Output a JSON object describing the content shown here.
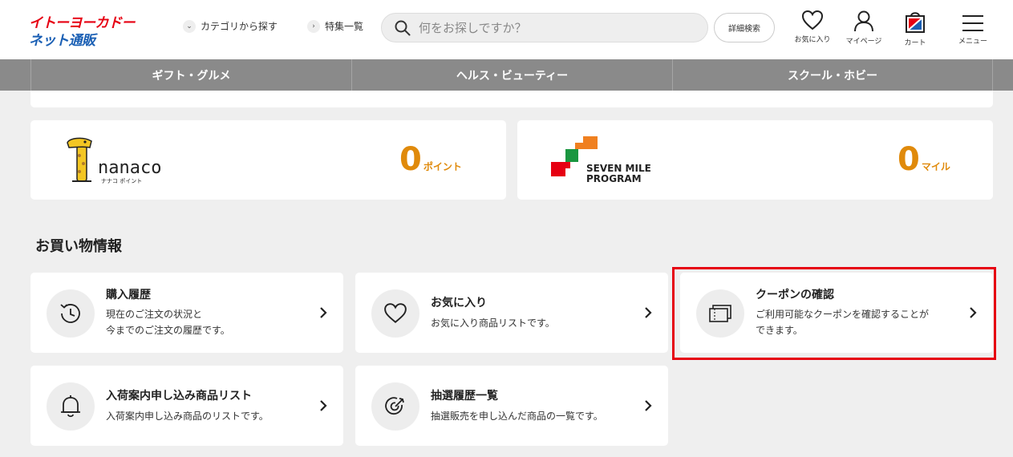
{
  "header": {
    "logo_line1": "イトーヨーカドー",
    "logo_line2": "ネット通販",
    "category_link": "カテゴリから探す",
    "feature_link": "特集一覧",
    "search_placeholder": "何をお探しですか？",
    "advanced_search": "詳細検索",
    "favorites": "お気に入り",
    "mypage": "マイページ",
    "cart": "カート",
    "menu": "メニュー"
  },
  "categories": [
    "ギフト・グルメ",
    "ヘルス・ビューティー",
    "スクール・ホビー"
  ],
  "points": {
    "nanaco": {
      "logo_text": "nanaco",
      "logo_sub": "ナナコ ポイント",
      "value": "0",
      "unit": "ポイント"
    },
    "seven_mile": {
      "logo_line1": "SEVEN MILE",
      "logo_line2": "PROGRAM",
      "value": "0",
      "unit": "マイル"
    }
  },
  "shopping": {
    "title": "お買い物情報",
    "items": [
      {
        "title": "購入履歴",
        "desc1": "現在のご注文の状況と",
        "desc2": "今までのご注文の履歴です。"
      },
      {
        "title": "お気に入り",
        "desc1": "お気に入り商品リストです。",
        "desc2": ""
      },
      {
        "title": "クーポンの確認",
        "desc1": "ご利用可能なクーポンを確認することが",
        "desc2": "できます。"
      },
      {
        "title": "入荷案内申し込み商品リスト",
        "desc1": "入荷案内申し込み商品のリストです。",
        "desc2": ""
      },
      {
        "title": "抽選履歴一覧",
        "desc1": "抽選販売を申し込んだ商品の一覧です。",
        "desc2": ""
      }
    ]
  },
  "colors": {
    "accent": "#e08a0b",
    "brand_red": "#e60012",
    "brand_blue": "#1a5fb4",
    "catbar": "#8a8a8a"
  }
}
